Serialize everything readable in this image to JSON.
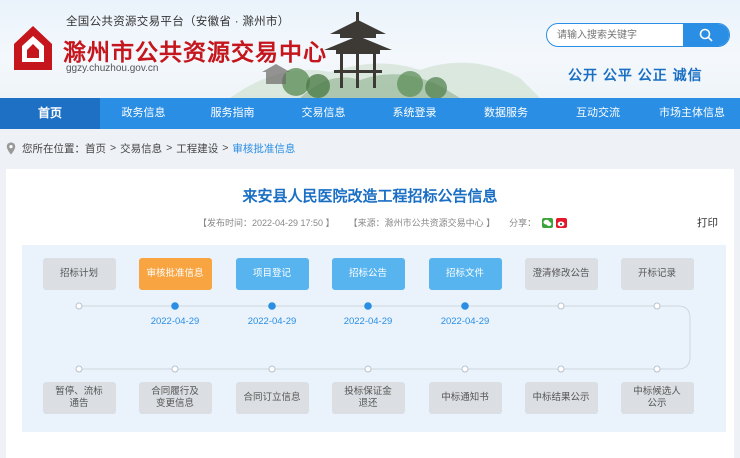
{
  "header": {
    "platform": "全国公共资源交易平台（安徽省 · 滁州市）",
    "site_name": "滁州市公共资源交易中心",
    "site_url": "ggzy.chuzhou.gov.cn",
    "search_placeholder": "请输入搜索关键字",
    "motto": "公开 公平 公正 诚信",
    "logo_icon": "chuzhou-logo-icon",
    "search_icon": "search-icon",
    "accent_color": "#2a8ee4",
    "brand_red": "#c4161c"
  },
  "nav": {
    "items": [
      "首页",
      "政务信息",
      "服务指南",
      "交易信息",
      "系统登录",
      "数据服务",
      "互动交流",
      "市场主体信息"
    ],
    "active": "首页"
  },
  "breadcrumb": {
    "prefix": "您所在位置：",
    "items": [
      "首页",
      "交易信息",
      "工程建设",
      "审核批准信息"
    ],
    "separator": ">"
  },
  "article": {
    "title": "来安县人民医院改造工程招标公告信息",
    "published": "【发布时间：2022-04-29 17:50 】",
    "source": "【来源：滁州市公共资源交易中心 】",
    "share_label": "分享：",
    "print_label": "打印"
  },
  "flow": {
    "top_steps": [
      {
        "label": "招标计划",
        "state": "grey",
        "date": ""
      },
      {
        "label": "审核批准信息",
        "state": "orange",
        "date": "2022-04-29"
      },
      {
        "label": "项目登记",
        "state": "blue",
        "date": "2022-04-29"
      },
      {
        "label": "招标公告",
        "state": "blue",
        "date": "2022-04-29"
      },
      {
        "label": "招标文件",
        "state": "blue",
        "date": "2022-04-29"
      },
      {
        "label": "澄清修改公告",
        "state": "grey",
        "date": ""
      },
      {
        "label": "开标记录",
        "state": "grey",
        "date": ""
      }
    ],
    "bottom_steps": [
      {
        "label": "暂停、流标\n通告",
        "state": "grey"
      },
      {
        "label": "合同履行及\n变更信息",
        "state": "grey"
      },
      {
        "label": "合同订立信息",
        "state": "grey"
      },
      {
        "label": "投标保证金\n退还",
        "state": "grey"
      },
      {
        "label": "中标通知书",
        "state": "grey"
      },
      {
        "label": "中标结果公示",
        "state": "grey"
      },
      {
        "label": "中标候选人\n公示",
        "state": "grey"
      }
    ],
    "colors": {
      "done": "#57b4ef",
      "current": "#f7a441",
      "pending": "#dbdee2"
    }
  }
}
